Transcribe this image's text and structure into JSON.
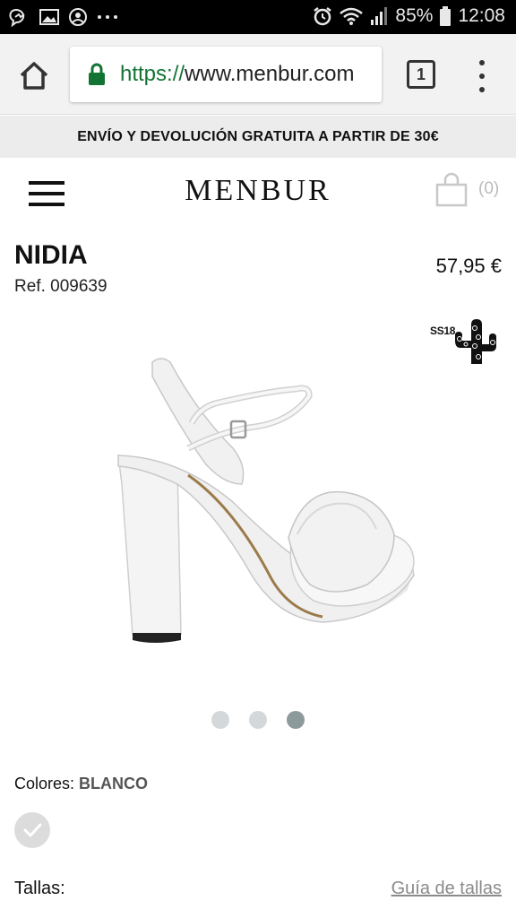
{
  "status_bar": {
    "battery": "85%",
    "time": "12:08",
    "icons": [
      "messenger-icon",
      "image-icon",
      "account-icon",
      "more-icon",
      "alarm-icon",
      "wifi-icon",
      "signal-icon",
      "battery-icon"
    ]
  },
  "browser": {
    "url_scheme": "https://",
    "url_host": "www.menbur.com",
    "tab_count": "1"
  },
  "promo": {
    "text": "ENVÍO Y DEVOLUCIÓN GRATUITA A PARTIR DE 30€"
  },
  "header": {
    "logo": "MENBUR",
    "cart_count": "(0)"
  },
  "product": {
    "name": "NIDIA",
    "ref": "Ref. 009639",
    "price": "57,95 €",
    "season": "SS18",
    "colors_label": "Colores:",
    "color_value": "BLANCO",
    "sizes_label": "Tallas:",
    "size_guide": "Guía de tallas"
  },
  "carousel": {
    "count": 3,
    "active_index": 2
  },
  "colors": {
    "dot_inactive": "#d3d8da",
    "dot_active": "#8d9a9c",
    "secure_green": "#137333"
  }
}
